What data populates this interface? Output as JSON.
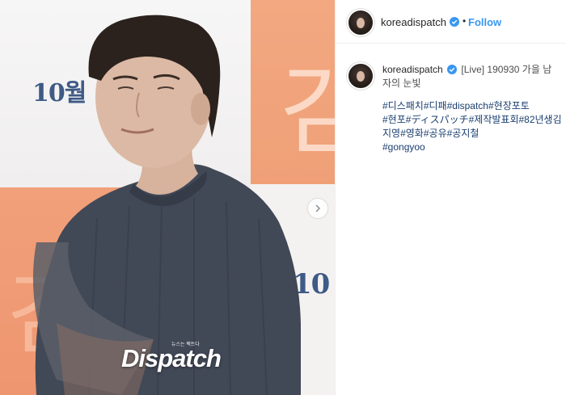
{
  "photo": {
    "background_text_1": "10월",
    "background_text_2": "10",
    "background_glyph_1": "김",
    "background_glyph_2": "김",
    "watermark": "Dispatch",
    "watermark_sub": "뉴스는 팩트다",
    "carousel_next_icon": "chevron-right-icon",
    "colors": {
      "orange": "#f1a07a",
      "navy_text": "#3e5a86",
      "sweater": "#3f4654"
    }
  },
  "header": {
    "username": "koreadispatch",
    "separator": "•",
    "follow_label": "Follow",
    "verified_icon": "verified-badge-icon",
    "colors": {
      "follow": "#3897f0",
      "verified": "#3897f0"
    }
  },
  "caption": {
    "username": "koreadispatch",
    "text": "[Live] 190930 가을 남자의 눈빛",
    "hashtags": [
      "#디스패치",
      "#디패",
      "#dispatch",
      "#현장포토",
      "#현포",
      "#ディスパッチ",
      "#제작발표회",
      "#82년생김지영",
      "#영화",
      "#공유",
      "#공지철",
      "#gongyoo"
    ]
  }
}
